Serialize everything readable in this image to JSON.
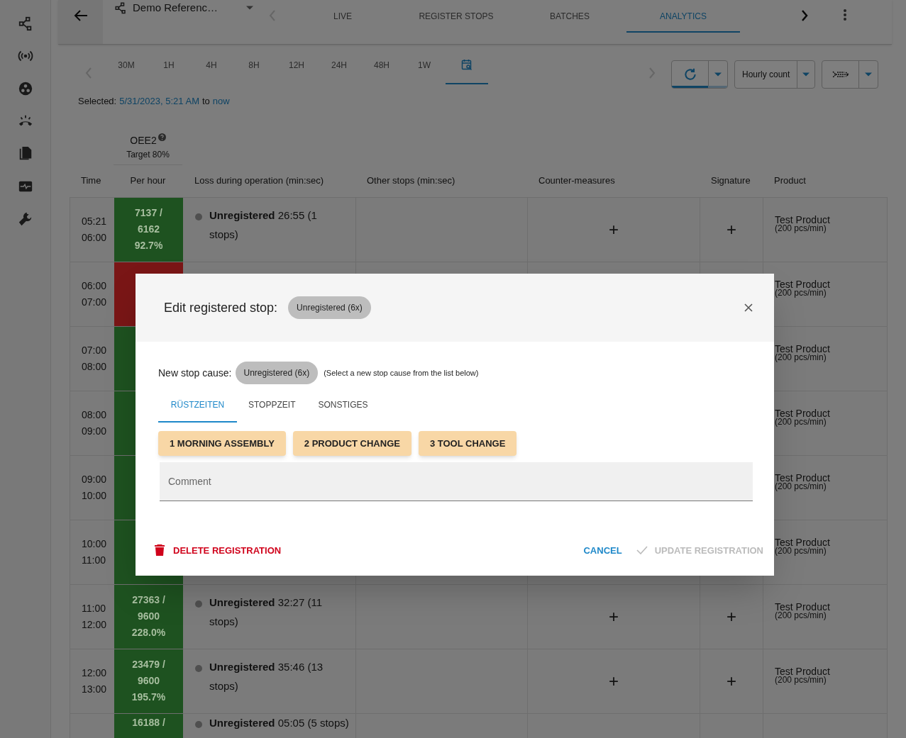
{
  "header": {
    "line_selector": "Demo Referenc…",
    "tabs": [
      {
        "label": "LIVE",
        "selected": false
      },
      {
        "label": "REGISTER STOPS",
        "selected": false
      },
      {
        "label": "BATCHES",
        "selected": false
      },
      {
        "label": "ANALYTICS",
        "selected": true
      }
    ]
  },
  "range": {
    "tabs": [
      {
        "kind": "text",
        "label": "30M",
        "selected": false
      },
      {
        "kind": "text",
        "label": "1H",
        "selected": false
      },
      {
        "kind": "text",
        "label": "4H",
        "selected": false
      },
      {
        "kind": "text",
        "label": "8H",
        "selected": false
      },
      {
        "kind": "text",
        "label": "12H",
        "selected": false
      },
      {
        "kind": "text",
        "label": "24H",
        "selected": false
      },
      {
        "kind": "text",
        "label": "48H",
        "selected": false
      },
      {
        "kind": "text",
        "label": "1W",
        "selected": false
      },
      {
        "kind": "calendar",
        "selected": true
      }
    ],
    "refresh_active": true,
    "metric_select": "Hourly count",
    "selected_prefix": "Selected:",
    "selected_from": "5/31/2023, 5:21 AM",
    "selected_to_word": "to",
    "selected_to": "now"
  },
  "table": {
    "group_header": {
      "label": "OEE2",
      "sublabel": "Target 80%"
    },
    "columns": [
      "Time",
      "Per hour",
      "Loss during operation (min:sec)",
      "Other stops (min:sec)",
      "Counter-measures",
      "Signature",
      "Product"
    ],
    "rows": [
      {
        "time_from": "05:21",
        "time_to": "06:00",
        "per_hour": {
          "color": "#1e5220",
          "lines": [
            "7137 /",
            "6162",
            "92.7%"
          ]
        },
        "loss": {
          "label": "Unregistered",
          "detail": "26:55 (1 stops)"
        },
        "counter_add": "+",
        "signature_add": "+",
        "product": "Test Product",
        "product_rate": "(200 pcs/min)"
      },
      {
        "time_from": "06:00",
        "time_to": "07:00",
        "per_hour": {
          "color": "#7a1616"
        },
        "product": "Test Product",
        "product_rate": "(200 pcs/min)"
      },
      {
        "time_from": "07:00",
        "time_to": "08:00",
        "per_hour": {
          "color": "#1e5220"
        },
        "product": "Test Product",
        "product_rate": "(200 pcs/min)"
      },
      {
        "time_from": "08:00",
        "time_to": "09:00",
        "per_hour": {
          "color": "#1e5220"
        },
        "product": "Test Product",
        "product_rate": "(200 pcs/min)"
      },
      {
        "time_from": "09:00",
        "time_to": "10:00",
        "per_hour": {
          "color": "#1e5220"
        },
        "product": "Test Product",
        "product_rate": "(200 pcs/min)"
      },
      {
        "time_from": "10:00",
        "time_to": "11:00",
        "per_hour": {
          "color": "#1e5220"
        },
        "product": "Test Product",
        "product_rate": "(200 pcs/min)"
      },
      {
        "time_from": "11:00",
        "time_to": "12:00",
        "per_hour": {
          "color": "#1e5220",
          "lines": [
            "27363 /",
            "9600",
            "228.0%"
          ]
        },
        "loss": {
          "label": "Unregistered",
          "detail": "32:27 (11 stops)"
        },
        "counter_add": "+",
        "signature_add": "+",
        "product": "Test Product",
        "product_rate": "(200 pcs/min)"
      },
      {
        "time_from": "12:00",
        "time_to": "13:00",
        "per_hour": {
          "color": "#1e5220",
          "lines": [
            "23479 /",
            "9600",
            "195.7%"
          ]
        },
        "loss": {
          "label": "Unregistered",
          "detail": "35:46 (13 stops)"
        },
        "counter_add": "+",
        "signature_add": "+",
        "product": "Test Product",
        "product_rate": "(200 pcs/min)"
      },
      {
        "per_hour": {
          "color": "#1e5220",
          "lines": [
            "16188 /"
          ]
        },
        "loss": {
          "label": "Unregistered",
          "detail": "05:05 (5 stops)"
        }
      }
    ]
  },
  "dialog": {
    "title": "Edit registered stop:",
    "current_cause": "Unregistered (6x)",
    "new_cause_label": "New stop cause:",
    "new_cause": "Unregistered (6x)",
    "hint": "(Select a new stop cause from the list below)",
    "tabs": [
      {
        "label": "RÜSTZEITEN",
        "selected": true
      },
      {
        "label": "STOPPZEIT",
        "selected": false
      },
      {
        "label": "SONSTIGES",
        "selected": false
      }
    ],
    "causes": [
      "1 MORNING ASSEMBLY",
      "2 PRODUCT CHANGE",
      "3 TOOL CHANGE"
    ],
    "comment_placeholder": "Comment",
    "delete": "DELETE REGISTRATION",
    "cancel": "CANCEL",
    "update": {
      "label": "UPDATE REGISTRATION",
      "disabled": true
    }
  }
}
